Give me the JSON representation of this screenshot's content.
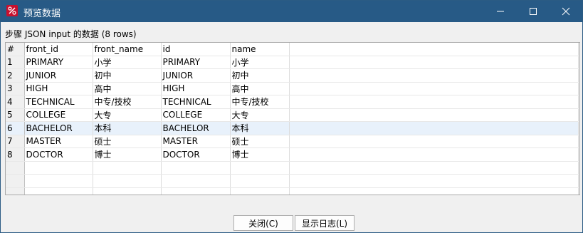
{
  "window": {
    "title": "预览数据"
  },
  "caption": "步骤 JSON input 的数据  (8 rows)",
  "table": {
    "headers": [
      "#",
      "front_id",
      "front_name",
      "id",
      "name"
    ],
    "rows": [
      [
        "1",
        "PRIMARY",
        "小学",
        "PRIMARY",
        "小学"
      ],
      [
        "2",
        "JUNIOR",
        "初中",
        "JUNIOR",
        "初中"
      ],
      [
        "3",
        "HIGH",
        "高中",
        "HIGH",
        "高中"
      ],
      [
        "4",
        "TECHNICAL",
        "中专/技校",
        "TECHNICAL",
        "中专/技校"
      ],
      [
        "5",
        "COLLEGE",
        "大专",
        "COLLEGE",
        "大专"
      ],
      [
        "6",
        "BACHELOR",
        "本科",
        "BACHELOR",
        "本科"
      ],
      [
        "7",
        "MASTER",
        "硕士",
        "MASTER",
        "硕士"
      ],
      [
        "8",
        "DOCTOR",
        "博士",
        "DOCTOR",
        "博士"
      ]
    ],
    "selected_row": 6
  },
  "buttons": {
    "close": "关闭(C)",
    "show_log": "显示日志(L)"
  },
  "colors": {
    "titlebar": "#275a86",
    "selected_row": "#e8f1fb",
    "app_icon": "#c8102e"
  }
}
